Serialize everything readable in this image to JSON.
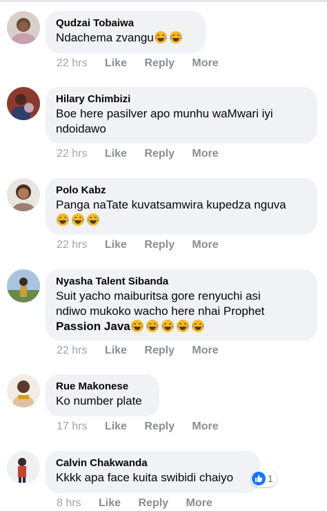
{
  "comments": [
    {
      "author": "Qudzai Tobaiwa",
      "lines": [
        "Ndachema zvangu"
      ],
      "emoji_count": 2,
      "time": "22 hrs",
      "like": "Like",
      "reply": "Reply",
      "more": "More"
    },
    {
      "author": "Hilary Chimbizi",
      "lines": [
        "Boe here pasilver apo munhu waMwari iyi",
        "ndoidawo"
      ],
      "emoji_count": 0,
      "time": "22 hrs",
      "like": "Like",
      "reply": "Reply",
      "more": "More"
    },
    {
      "author": "Polo Kabz",
      "lines": [
        "Panga naTate kuvatsamwira kupedza nguva"
      ],
      "emoji_count": 3,
      "time": "22 hrs",
      "like": "Like",
      "reply": "Reply",
      "more": "More"
    },
    {
      "author": "Nyasha Talent Sibanda",
      "lines": [
        "Suit yacho maiburitsa gore renyuchi asi",
        "ndiwo mukoko wacho here nhai Prophet"
      ],
      "tag": "Passion Java",
      "emoji_count": 5,
      "time": "22 hrs",
      "like": "Like",
      "reply": "Reply",
      "more": "More"
    },
    {
      "author": "Rue Makonese",
      "lines": [
        "Ko number plate"
      ],
      "emoji_count": 0,
      "time": "17 hrs",
      "like": "Like",
      "reply": "Reply",
      "more": "More"
    },
    {
      "author": "Calvin Chakwanda",
      "lines": [
        "Kkkk apa face kuita swibidi chaiyo"
      ],
      "emoji_count": 0,
      "time": "8 hrs",
      "like": "Like",
      "reply": "Reply",
      "more": "More",
      "reaction_count": "1"
    }
  ],
  "colors": {
    "bubble": "#f0f2f5",
    "action_text": "#8a8d91",
    "like_blue": "#1877f2",
    "emoji_yellow": "#f7b928"
  }
}
